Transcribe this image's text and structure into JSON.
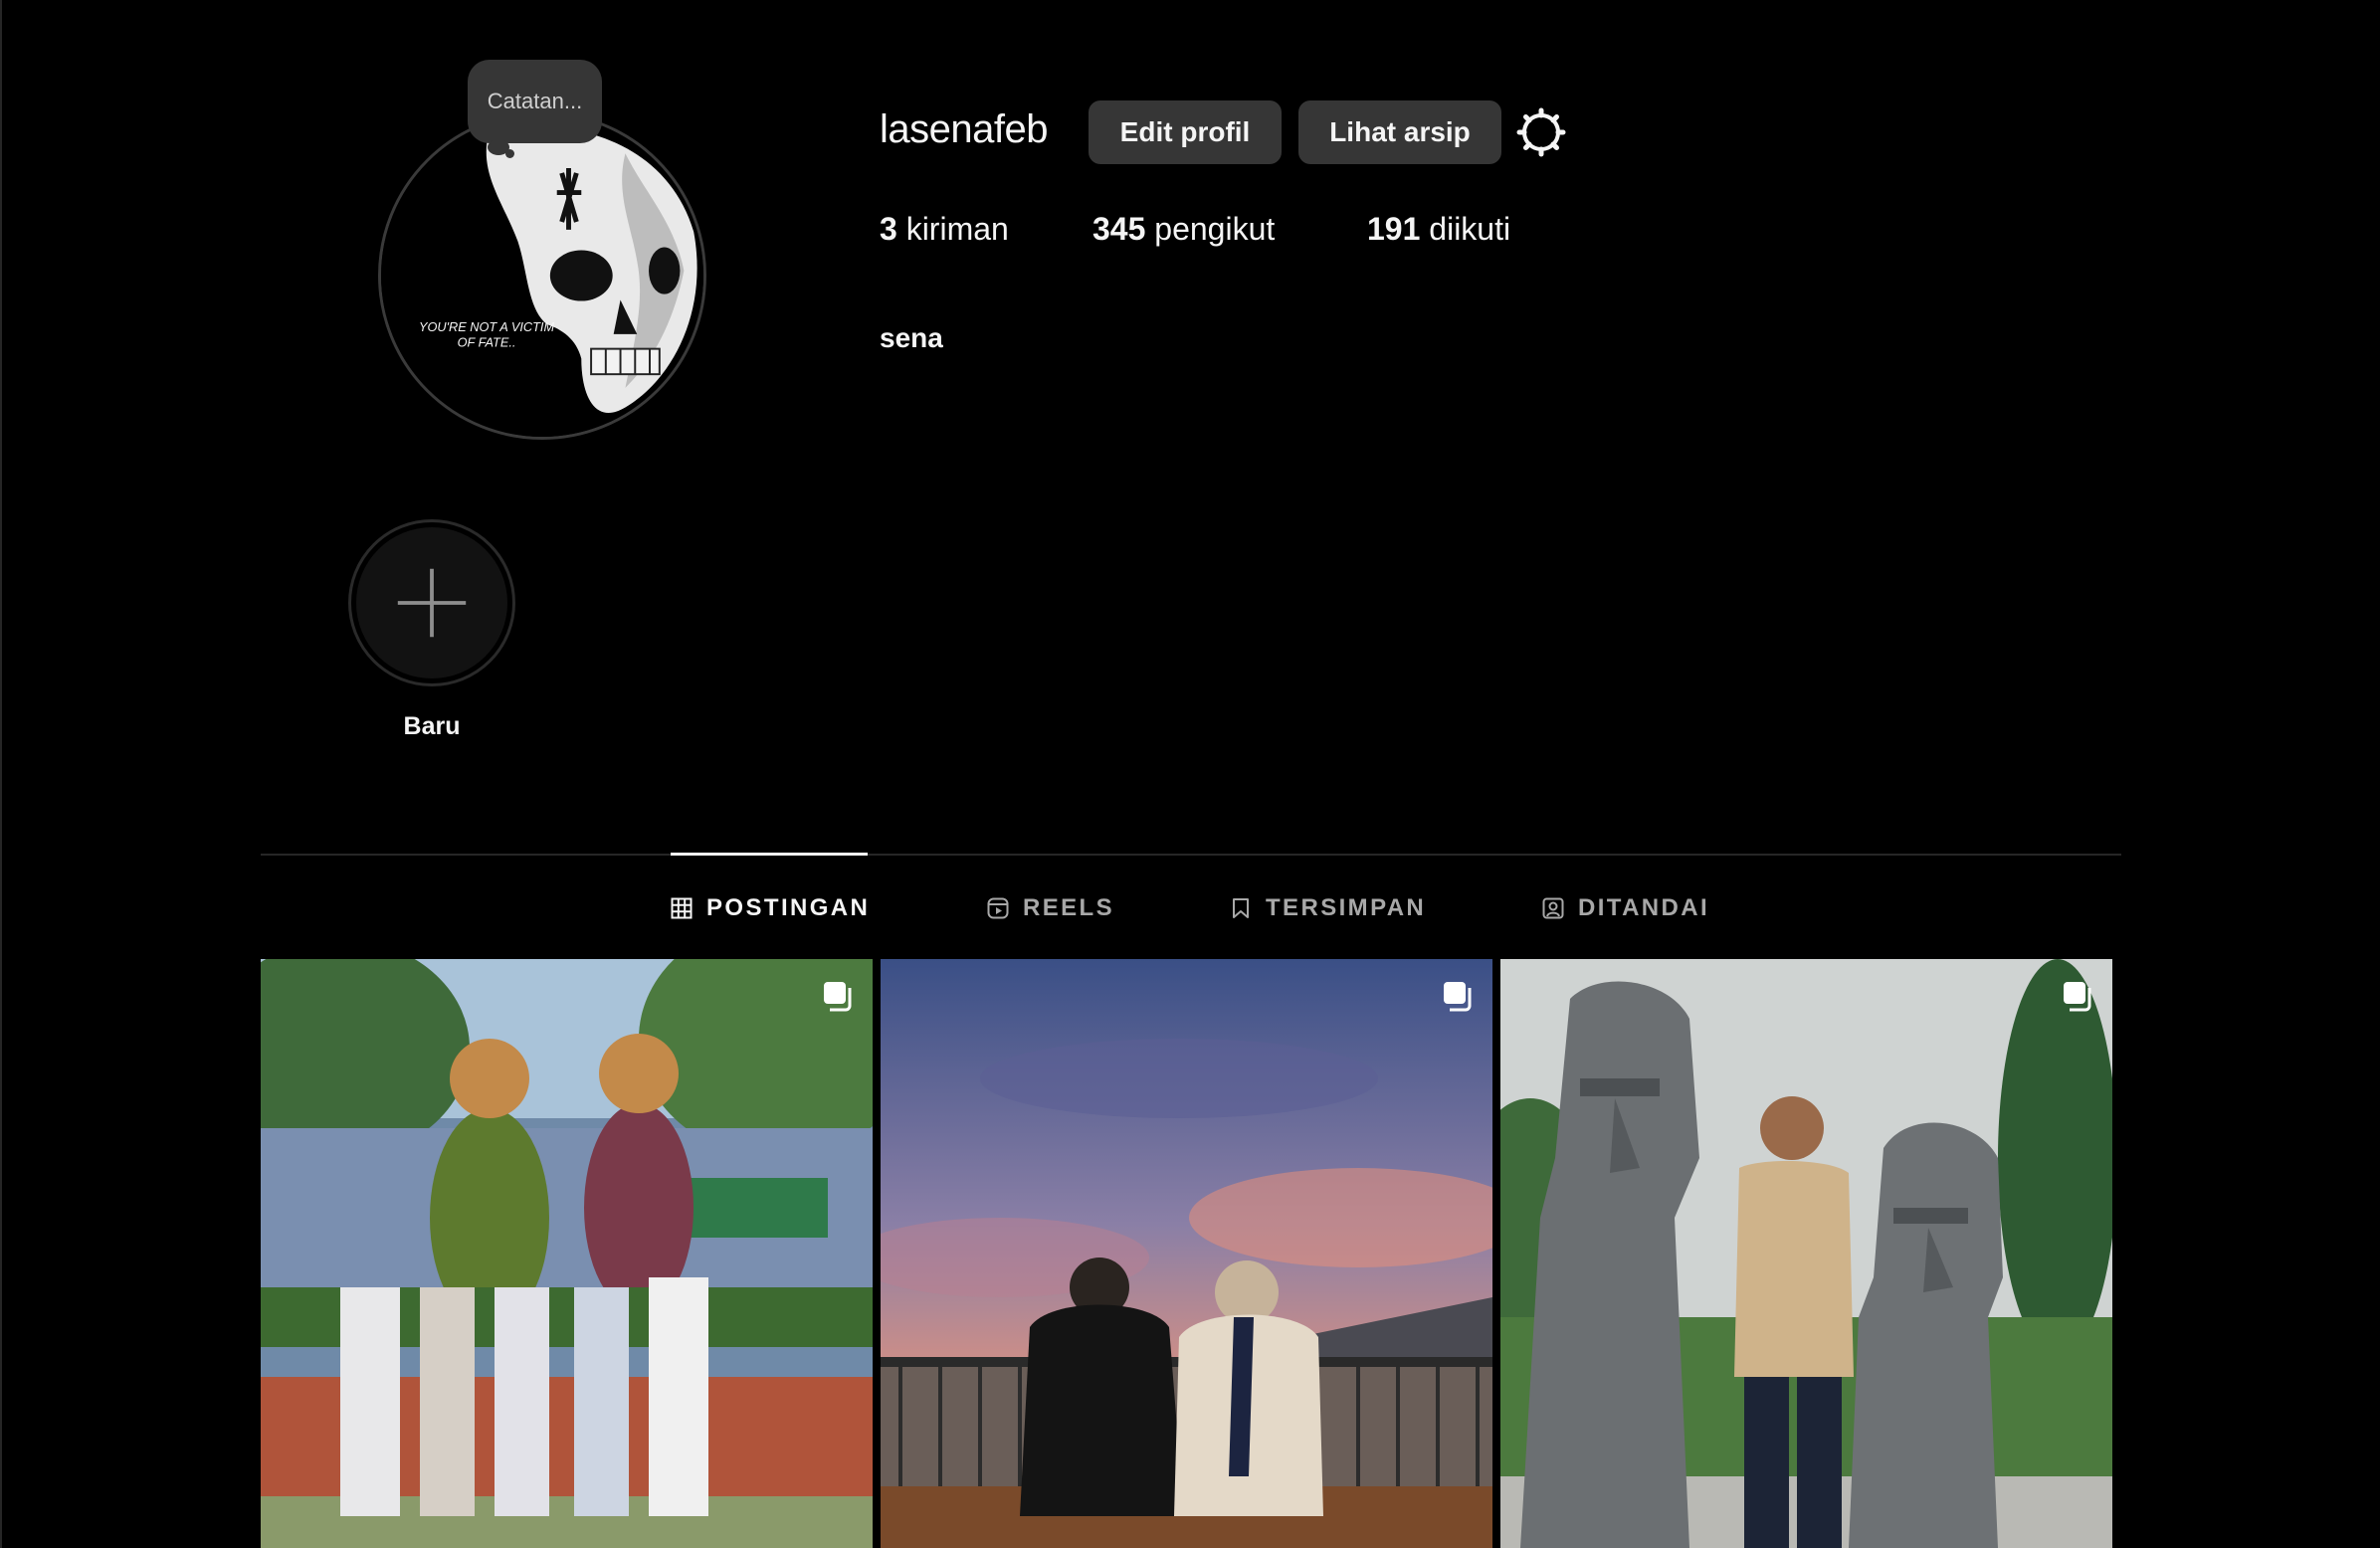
{
  "profile": {
    "note_placeholder": "Catatan...",
    "avatar_text_line1": "YOU'RE NOT A VICTIM",
    "avatar_text_line2": "OF FATE..",
    "username": "lasenafeb",
    "edit_button": "Edit profil",
    "archive_button": "Lihat arsip",
    "settings_icon": "gear-icon",
    "full_name": "sena"
  },
  "stats": {
    "posts_count": "3",
    "posts_label": " kiriman",
    "followers_count": "345",
    "followers_label": " pengikut",
    "following_count": "191",
    "following_label": " diikuti"
  },
  "highlights": {
    "new_label": "Baru",
    "new_icon": "plus-icon"
  },
  "tabs": [
    {
      "label": "POSTINGAN",
      "icon": "grid-icon",
      "active": true
    },
    {
      "label": "REELS",
      "icon": "reels-icon",
      "active": false
    },
    {
      "label": "TERSIMPAN",
      "icon": "bookmark-icon",
      "active": false
    },
    {
      "label": "DITANDAI",
      "icon": "tagged-icon",
      "active": false
    }
  ],
  "posts": [
    {
      "subject": "group photo at theme park with flower mascots",
      "type_icon": "carousel-icon"
    },
    {
      "subject": "couple sitting facing sunset sky",
      "type_icon": "carousel-icon"
    },
    {
      "subject": "person standing between two moai statues",
      "type_icon": "carousel-icon"
    }
  ],
  "colors": {
    "background": "#000000",
    "button_bg": "#363636",
    "text_primary": "#f5f5f5",
    "text_secondary": "#a8a8a8",
    "divider": "#262626"
  }
}
